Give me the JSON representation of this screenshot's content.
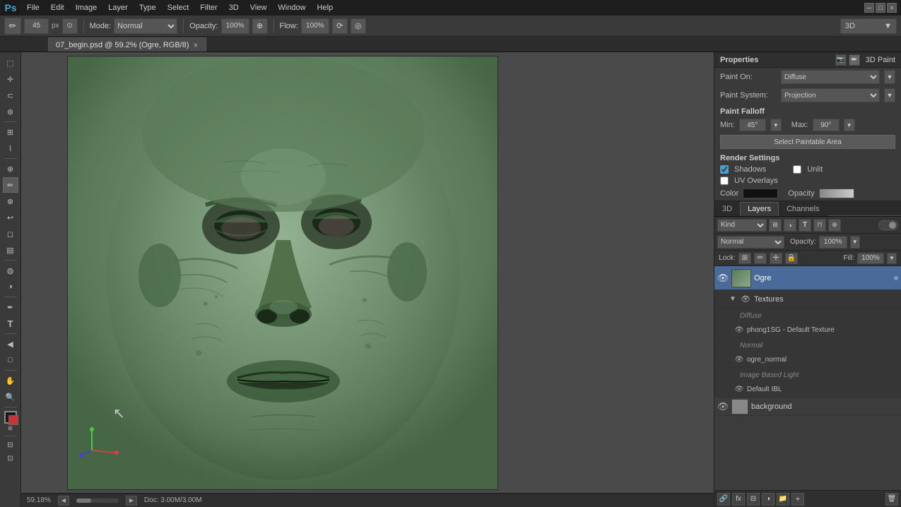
{
  "app": {
    "logo": "Ps",
    "title": "Adobe Photoshop"
  },
  "menubar": {
    "items": [
      "File",
      "Edit",
      "Image",
      "Layer",
      "Type",
      "Select",
      "Filter",
      "3D",
      "View",
      "Window",
      "Help"
    ]
  },
  "toolbar": {
    "brush_size": "45",
    "brush_size_unit": "px",
    "mode_label": "Mode:",
    "mode_value": "Normal",
    "opacity_label": "Opacity:",
    "opacity_value": "100%",
    "flow_label": "Flow:",
    "flow_value": "100%",
    "label_3d": "3D"
  },
  "tab": {
    "title": "07_begin.psd @ 59.2% (Ogre, RGB/8)",
    "close": "×"
  },
  "canvas": {
    "zoom": "59.18%",
    "doc_size": "Doc: 3.00M/3.00M"
  },
  "properties": {
    "title": "Properties",
    "paint_title": "3D Paint",
    "paint_on_label": "Paint On:",
    "paint_on_value": "Diffuse",
    "paint_system_label": "Paint System:",
    "paint_system_value": "Projection",
    "paint_falloff_label": "Paint Falloff",
    "min_label": "Min:",
    "min_value": "45°",
    "max_label": "Max:",
    "max_value": "90°",
    "select_paintable_btn": "Select Paintable Area",
    "render_settings_label": "Render Settings",
    "shadows_label": "Shadows",
    "unlit_label": "Unlit",
    "uv_overlays_label": "UV Overlays",
    "color_label": "Color",
    "opacity_label": "Opacity"
  },
  "layers": {
    "tabs": [
      "3D",
      "Layers",
      "Channels"
    ],
    "active_tab": "Layers",
    "search_placeholder": "Kind",
    "mode_value": "Normal",
    "opacity_label": "Opacity:",
    "opacity_value": "100%",
    "lock_label": "Lock:",
    "fill_label": "Fill:",
    "fill_value": "100%",
    "items": [
      {
        "name": "Ogre",
        "type": "layer",
        "visible": true,
        "selected": true
      },
      {
        "name": "Textures",
        "type": "group",
        "visible": true,
        "indent": 1
      },
      {
        "name": "Diffuse",
        "type": "sublabel",
        "visible": false,
        "indent": 2
      },
      {
        "name": "phong1SG - Default Texture",
        "type": "sublabel",
        "visible": true,
        "indent": 2
      },
      {
        "name": "Normal",
        "type": "sublabel2",
        "visible": false,
        "indent": 2
      },
      {
        "name": "ogre_normal",
        "type": "subitem",
        "visible": true,
        "indent": 3
      },
      {
        "name": "Image Based Light",
        "type": "sublabel",
        "visible": false,
        "indent": 2
      },
      {
        "name": "Default IBL",
        "type": "subitem",
        "visible": true,
        "indent": 3
      },
      {
        "name": "background",
        "type": "layer",
        "visible": true,
        "indent": 0
      }
    ]
  }
}
